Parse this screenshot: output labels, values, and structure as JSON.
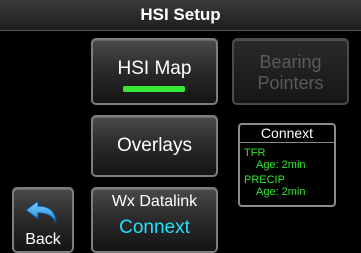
{
  "title": "HSI Setup",
  "buttons": {
    "hsi_map": "HSI Map",
    "bearing_line1": "Bearing",
    "bearing_line2": "Pointers",
    "overlays": "Overlays",
    "wx_title": "Wx Datalink",
    "wx_value": "Connext",
    "back": "Back"
  },
  "connext": {
    "title": "Connext",
    "products": [
      {
        "name": "TFR",
        "age": "Age: 2min"
      },
      {
        "name": "PRECIP",
        "age": "Age: 2min"
      }
    ]
  },
  "colors": {
    "selected_indicator": "#38e838",
    "connext_value": "#22e0ff",
    "product_text": "#2ee82e"
  }
}
